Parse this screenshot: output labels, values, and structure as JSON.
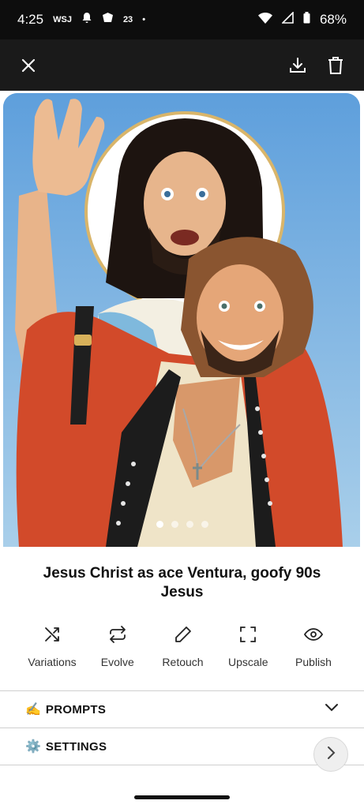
{
  "status_bar": {
    "time": "4:25",
    "wsj": "WSJ",
    "number": "23",
    "dot": "•",
    "battery": "68%"
  },
  "image": {
    "description_icon": "image"
  },
  "title": "Jesus Christ as ace Ventura, goofy 90s Jesus",
  "actions": [
    {
      "label": "Variations",
      "icon": "shuffle-icon"
    },
    {
      "label": "Evolve",
      "icon": "repeat-icon"
    },
    {
      "label": "Retouch",
      "icon": "pencil-icon"
    },
    {
      "label": "Upscale",
      "icon": "expand-icon"
    },
    {
      "label": "Publish",
      "icon": "eye-icon"
    }
  ],
  "sections": {
    "prompts": {
      "emoji": "✍️",
      "label": "PROMPTS"
    },
    "settings": {
      "emoji": "⚙️",
      "label": "SETTINGS"
    }
  },
  "colors": {
    "status_bg": "#0d0d0d",
    "topbar_bg": "#1a1a1a",
    "sky": "#6aa5d8"
  }
}
